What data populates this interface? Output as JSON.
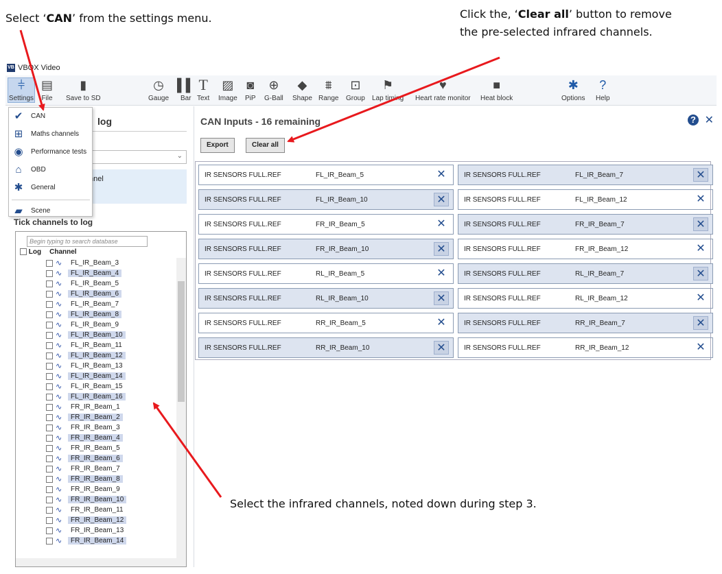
{
  "annotations": {
    "can_pre": "Select ‘",
    "can_bold": "CAN",
    "can_post": "’ from the settings menu.",
    "clear_pre": "Click the, ‘",
    "clear_bold": "Clear all",
    "clear_post": "’ button to remove",
    "clear_line2": "the pre-selected infrared channels.",
    "select": "Select the infrared channels, noted down during step 3."
  },
  "window": {
    "title": "VBOX Video"
  },
  "toolbar": {
    "settings": "Settings",
    "file": "File",
    "save_sd": "Save to SD",
    "gauge": "Gauge",
    "bar": "Bar",
    "text": "Text",
    "image": "Image",
    "pip": "PiP",
    "gball": "G-Ball",
    "shape": "Shape",
    "range": "Range",
    "group": "Group",
    "lap_timing": "Lap timing",
    "heart_rate": "Heart rate monitor",
    "heat_block": "Heat block",
    "options": "Options",
    "help": "Help"
  },
  "settings_menu": {
    "can": "CAN",
    "maths": "Maths channels",
    "performance": "Performance tests",
    "obd": "OBD",
    "general": "General",
    "scene": "Scene"
  },
  "left_panel": {
    "title": "log",
    "band_text": "nnel",
    "tick_title": "Tick channels to log",
    "search_placeholder": "Begin typing to search database",
    "col_log": "Log",
    "col_channel": "Channel"
  },
  "channels": [
    {
      "name": "FL_IR_Beam_3",
      "hl": false
    },
    {
      "name": "FL_IR_Beam_4",
      "hl": true
    },
    {
      "name": "FL_IR_Beam_5",
      "hl": false
    },
    {
      "name": "FL_IR_Beam_6",
      "hl": true
    },
    {
      "name": "FL_IR_Beam_7",
      "hl": false
    },
    {
      "name": "FL_IR_Beam_8",
      "hl": true
    },
    {
      "name": "FL_IR_Beam_9",
      "hl": false
    },
    {
      "name": "FL_IR_Beam_10",
      "hl": true
    },
    {
      "name": "FL_IR_Beam_11",
      "hl": false
    },
    {
      "name": "FL_IR_Beam_12",
      "hl": true
    },
    {
      "name": "FL_IR_Beam_13",
      "hl": false
    },
    {
      "name": "FL_IR_Beam_14",
      "hl": true
    },
    {
      "name": "FL_IR_Beam_15",
      "hl": false
    },
    {
      "name": "FL_IR_Beam_16",
      "hl": true
    },
    {
      "name": "FR_IR_Beam_1",
      "hl": false
    },
    {
      "name": "FR_IR_Beam_2",
      "hl": true
    },
    {
      "name": "FR_IR_Beam_3",
      "hl": false
    },
    {
      "name": "FR_IR_Beam_4",
      "hl": true
    },
    {
      "name": "FR_IR_Beam_5",
      "hl": false
    },
    {
      "name": "FR_IR_Beam_6",
      "hl": true
    },
    {
      "name": "FR_IR_Beam_7",
      "hl": false
    },
    {
      "name": "FR_IR_Beam_8",
      "hl": true
    },
    {
      "name": "FR_IR_Beam_9",
      "hl": false
    },
    {
      "name": "FR_IR_Beam_10",
      "hl": true
    },
    {
      "name": "FR_IR_Beam_11",
      "hl": false
    },
    {
      "name": "FR_IR_Beam_12",
      "hl": true
    },
    {
      "name": "FR_IR_Beam_13",
      "hl": false
    },
    {
      "name": "FR_IR_Beam_14",
      "hl": true
    }
  ],
  "can_inputs": {
    "title": "CAN Inputs   - 16 remaining",
    "export": "Export",
    "clear_all": "Clear all",
    "rows": [
      [
        {
          "src": "IR SENSORS FULL.REF",
          "ch": "FL_IR_Beam_5"
        },
        {
          "src": "IR SENSORS FULL.REF",
          "ch": "FL_IR_Beam_7"
        }
      ],
      [
        {
          "src": "IR SENSORS FULL.REF",
          "ch": "FL_IR_Beam_10"
        },
        {
          "src": "IR SENSORS FULL.REF",
          "ch": "FL_IR_Beam_12"
        }
      ],
      [
        {
          "src": "IR SENSORS FULL.REF",
          "ch": "FR_IR_Beam_5"
        },
        {
          "src": "IR SENSORS FULL.REF",
          "ch": "FR_IR_Beam_7"
        }
      ],
      [
        {
          "src": "IR SENSORS FULL.REF",
          "ch": "FR_IR_Beam_10"
        },
        {
          "src": "IR SENSORS FULL.REF",
          "ch": "FR_IR_Beam_12"
        }
      ],
      [
        {
          "src": "IR SENSORS FULL.REF",
          "ch": "RL_IR_Beam_5"
        },
        {
          "src": "IR SENSORS FULL.REF",
          "ch": "RL_IR_Beam_7"
        }
      ],
      [
        {
          "src": "IR SENSORS FULL.REF",
          "ch": "RL_IR_Beam_10"
        },
        {
          "src": "IR SENSORS FULL.REF",
          "ch": "RL_IR_Beam_12"
        }
      ],
      [
        {
          "src": "IR SENSORS FULL.REF",
          "ch": "RR_IR_Beam_5"
        },
        {
          "src": "IR SENSORS FULL.REF",
          "ch": "RR_IR_Beam_7"
        }
      ],
      [
        {
          "src": "IR SENSORS FULL.REF",
          "ch": "RR_IR_Beam_10"
        },
        {
          "src": "IR SENSORS FULL.REF",
          "ch": "RR_IR_Beam_12"
        }
      ]
    ]
  },
  "colors": {
    "accent": "#234d8e",
    "arrow": "#e8191d",
    "highlight": "#cfd8ec"
  }
}
